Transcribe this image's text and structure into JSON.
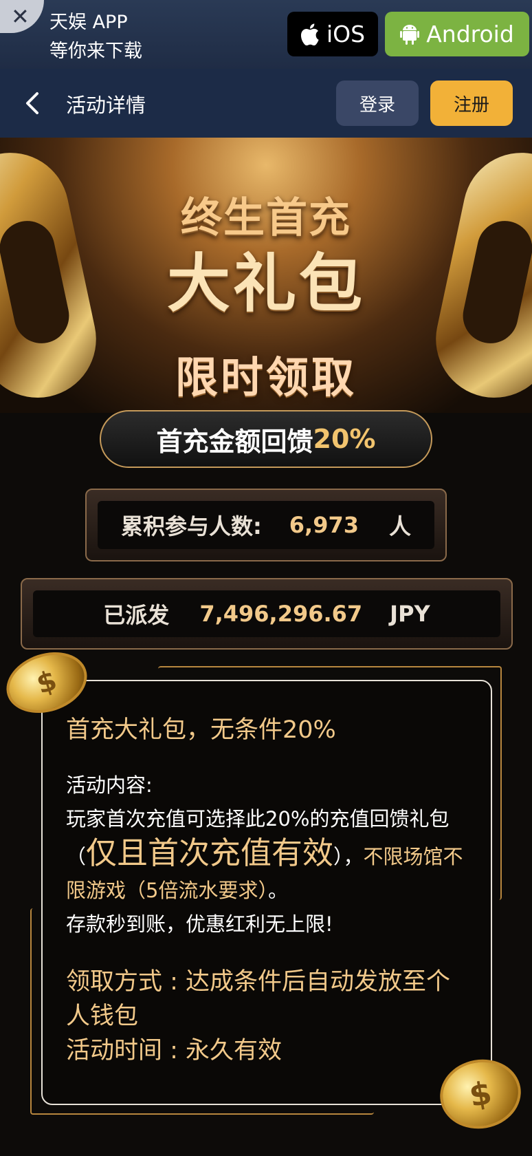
{
  "download_banner": {
    "close_glyph": "✕",
    "title": "天娱 APP",
    "subtitle": "等你来下载",
    "ios_label": "iOS",
    "android_label": "Android",
    "ios_color": "#000000",
    "android_color": "#7cb342"
  },
  "nav": {
    "title": "活动详情",
    "login_label": "登录",
    "register_label": "注册",
    "register_color": "#f2b138"
  },
  "hero": {
    "line1": "终生首充",
    "line2": "大礼包",
    "line3": "限时领取"
  },
  "rebate": {
    "label": "首充金额回馈",
    "percent": "20%"
  },
  "participants": {
    "label": "累积参与人数:",
    "value": "6,973",
    "unit": "人"
  },
  "distributed": {
    "label": "已派发",
    "value": "7,496,296.67",
    "currency": "JPY"
  },
  "content": {
    "title": "首充大礼包，无条件20%",
    "section_label": "活动内容:",
    "body_1": "玩家首次充值可选择此20%的充值回馈礼包（",
    "body_highlight": "仅且首次充值有效",
    "body_2": "），",
    "body_gold": "不限场馆不限游戏（5倍流水要求）",
    "body_3": "。",
    "body_line2": "存款秒到账，优惠红利无上限!",
    "claim_method": "领取方式 : 达成条件后自动发放至个人钱包",
    "activity_time": "活动时间 : 永久有效"
  }
}
